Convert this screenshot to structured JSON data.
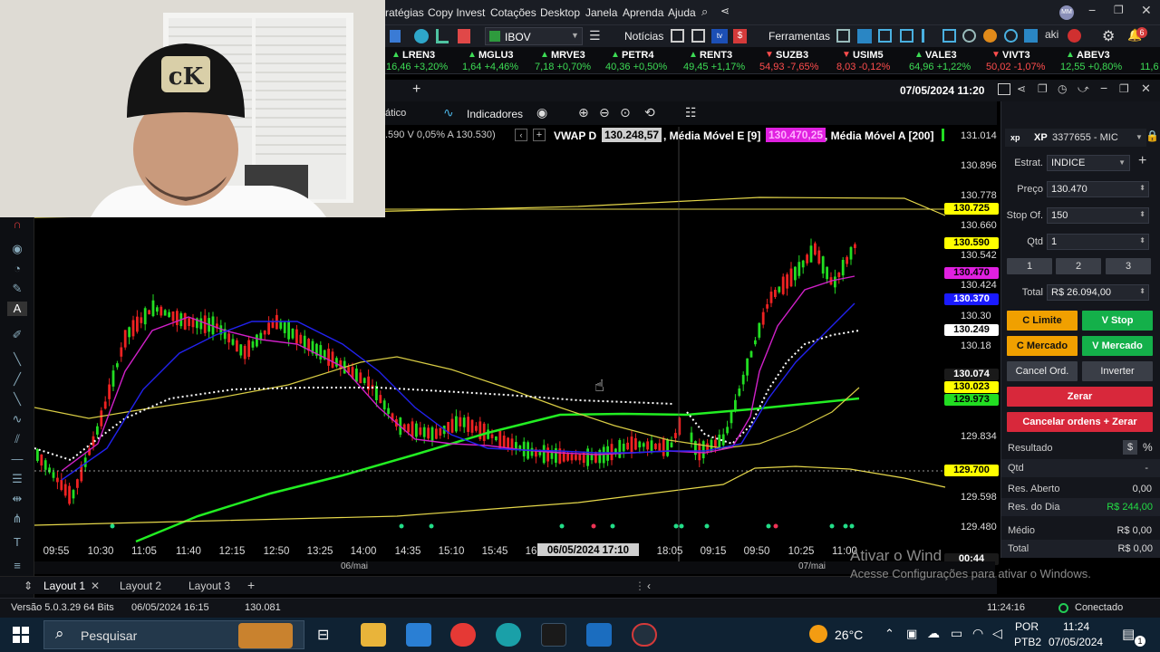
{
  "menubar": {
    "items": [
      "ratégias",
      "Copy Invest",
      "Cotações",
      "Desktop",
      "Janela",
      "Aprenda",
      "Ajuda"
    ],
    "avatar": "MM",
    "icons": [
      "search-icon",
      "share-icon",
      "minimize-icon",
      "restore-icon",
      "close-icon"
    ]
  },
  "toolbar": {
    "symbol_select": "IBOV",
    "noticias": "Notícias",
    "ferramentas": "Ferramentas",
    "notif_count": "6"
  },
  "ticker": [
    {
      "sym": "LREN3",
      "val": "16,46 +3,20%",
      "dir": "up"
    },
    {
      "sym": "MGLU3",
      "val": "1,64 +4,46%",
      "dir": "up"
    },
    {
      "sym": "MRVE3",
      "val": "7,18 +0,70%",
      "dir": "up"
    },
    {
      "sym": "PETR4",
      "val": "40,36 +0,50%",
      "dir": "up"
    },
    {
      "sym": "RENT3",
      "val": "49,45 +1,17%",
      "dir": "up"
    },
    {
      "sym": "SUZB3",
      "val": "54,93 -7,65%",
      "dir": "down"
    },
    {
      "sym": "USIM5",
      "val": "8,03 -0,12%",
      "dir": "down"
    },
    {
      "sym": "VALE3",
      "val": "64,96 +1,22%",
      "dir": "up"
    },
    {
      "sym": "VIVT3",
      "val": "50,02 -1,07%",
      "dir": "down"
    },
    {
      "sym": "ABEV3",
      "val": "12,55 +0,80%",
      "dir": "up"
    },
    {
      "sym": "",
      "val": "11,6",
      "dir": "up"
    }
  ],
  "chartwin": {
    "datetime": "07/05/2024 11:20",
    "tool_partial": "ático",
    "indicadores": "Indicadores"
  },
  "indicators_line": {
    "quote": ".590 V 0,05% A 130.530)",
    "vwap_label": "VWAP D",
    "vwap_value": "130.248,57",
    "mme_label": ", Média Móvel E [9]",
    "mme_value": "130.470,25",
    "mma_label": ", Média Móvel A [200]"
  },
  "yaxis": {
    "labels": [
      "131.014",
      "130.896",
      "130.778",
      "130.660",
      "130.542",
      "130.424",
      "130.30",
      "130.18",
      "129.834",
      "129.598",
      "129.480"
    ],
    "tags": [
      {
        "text": "130.725",
        "bg": "#ffff00",
        "fg": "#000000"
      },
      {
        "text": "130.590",
        "bg": "#ffff00",
        "fg": "#000000"
      },
      {
        "text": "130.470",
        "bg": "#e020e0",
        "fg": "#000000"
      },
      {
        "text": "130.370",
        "bg": "#1a1aff",
        "fg": "#ffffff"
      },
      {
        "text": "130.249",
        "bg": "#ffffff",
        "fg": "#000000"
      },
      {
        "text": "130.074",
        "bg": "#1a1a1a",
        "fg": "#ffffff"
      },
      {
        "text": "130.023",
        "bg": "#ffff00",
        "fg": "#000000"
      },
      {
        "text": "129.973",
        "bg": "#22dd22",
        "fg": "#000000"
      },
      {
        "text": "129.700",
        "bg": "#ffff00",
        "fg": "#000000"
      },
      {
        "text": "00:44",
        "bg": "#1a1a1a",
        "fg": "#ffffff"
      }
    ]
  },
  "xaxis": {
    "times": [
      "09:55",
      "10:30",
      "11:05",
      "11:40",
      "12:15",
      "12:50",
      "13:25",
      "14:00",
      "14:35",
      "15:10",
      "15:45",
      "16",
      "18:05",
      "09:15",
      "09:50",
      "10:25",
      "11:00"
    ],
    "cursor_label": "06/05/2024 17:10",
    "day1": "06/mai",
    "day2": "07/mai"
  },
  "tabs": [
    {
      "label": "Layout 1",
      "active": true
    },
    {
      "label": "Layout 2",
      "active": false
    },
    {
      "label": "Layout 3",
      "active": false
    }
  ],
  "status": {
    "version": "Versão 5.0.3.29 64 Bits",
    "datetime": "06/05/2024 16:15",
    "price": "130.081",
    "clock": "11:24:16",
    "connection": "Conectado"
  },
  "panel": {
    "account": "3377655 - MIC",
    "broker": "XP",
    "estrat_label": "Estrat.",
    "estrat_value": "INDICE",
    "preco_label": "Preço",
    "preco_value": "130.470",
    "stop_label": "Stop Of.",
    "stop_value": "150",
    "qtd_label": "Qtd",
    "qtd_value": "1",
    "quick_qty": [
      "1",
      "2",
      "3"
    ],
    "total_label": "Total",
    "total_value": "R$ 26.094,00",
    "btn_c_limite": "C Limite",
    "btn_v_stop": "V Stop",
    "btn_c_mercado": "C Mercado",
    "btn_v_mercado": "V Mercado",
    "btn_cancel": "Cancel Ord.",
    "btn_inverter": "Inverter",
    "btn_zerar": "Zerar",
    "btn_cancelar_zerar": "Cancelar ordens + Zerar",
    "resultado_label": "Resultado",
    "currency_btn": "$",
    "percent_btn": "%",
    "qtd2_label": "Qtd",
    "qtd2_value": "-",
    "res_aberto_label": "Res. Aberto",
    "res_aberto_value": "0,00",
    "res_dia_label": "Res. do Dia",
    "res_dia_value": "R$ 244,00",
    "medio_label": "Médio",
    "medio_value": "R$ 0,00",
    "total2_label": "Total",
    "total2_value": "R$ 0,00"
  },
  "watermark": {
    "line1": "Ativar o Wind",
    "line2": "Acesse Configurações para ativar o Windows."
  },
  "taskbar": {
    "search": "Pesquisar",
    "temp": "26°C",
    "lang1": "POR",
    "lang2": "PTB2",
    "time": "11:24",
    "date": "07/05/2024",
    "notif": "1"
  }
}
